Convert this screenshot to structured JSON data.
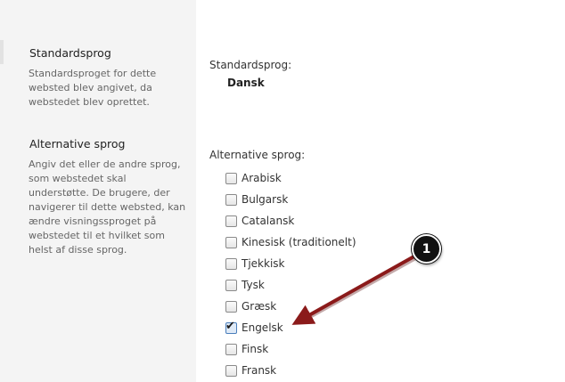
{
  "default_section": {
    "title": "Standardsprog",
    "description": "Standardsproget for dette websted blev angivet, da webstedet blev oprettet.",
    "field_label": "Standardsprog:",
    "value": "Dansk"
  },
  "alternative_section": {
    "title": "Alternative sprog",
    "description": "Angiv det eller de andre sprog, som webstedet skal understøtte. De brugere, der navigerer til dette websted, kan ændre visningssproget på webstedet til et hvilket som helst af disse sprog.",
    "field_label": "Alternative sprog:",
    "languages": [
      {
        "label": "Arabisk",
        "checked": false
      },
      {
        "label": "Bulgarsk",
        "checked": false
      },
      {
        "label": "Catalansk",
        "checked": false
      },
      {
        "label": "Kinesisk (traditionelt)",
        "checked": false
      },
      {
        "label": "Tjekkisk",
        "checked": false
      },
      {
        "label": "Tysk",
        "checked": false
      },
      {
        "label": "Græsk",
        "checked": false
      },
      {
        "label": "Engelsk",
        "checked": true
      },
      {
        "label": "Finsk",
        "checked": false
      },
      {
        "label": "Fransk",
        "checked": false
      }
    ]
  },
  "callout": {
    "number": "1",
    "color": "#8b1a1a"
  }
}
